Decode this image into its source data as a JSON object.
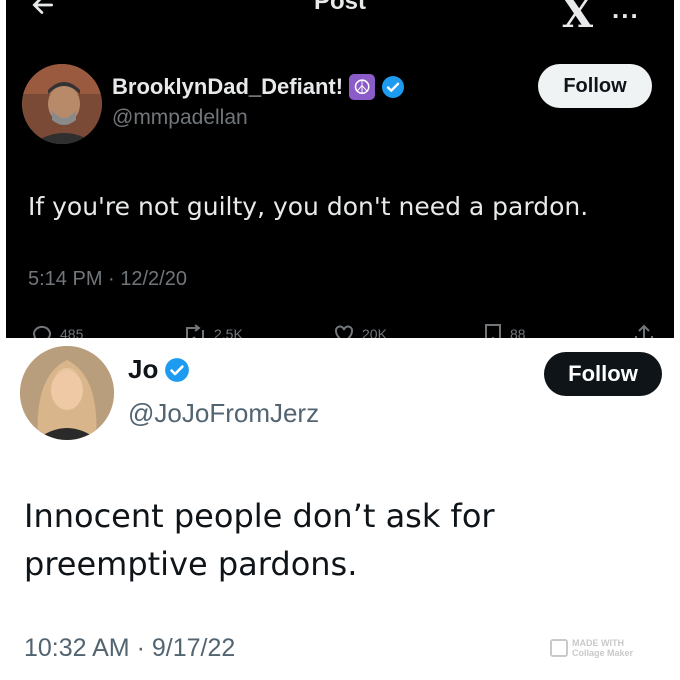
{
  "top_panel": {
    "header": {
      "title": "Post",
      "x_logo": "X",
      "more": "..."
    },
    "author": {
      "name": "BrooklynDad_Defiant!",
      "emoji": "☮",
      "handle": "@mmpadellan",
      "verified": true
    },
    "follow_label": "Follow",
    "text": "If you're not guilty, you don't need a pardon.",
    "timestamp": "5:14 PM · 12/2/20",
    "actions": {
      "replies": "485",
      "reposts": "2.5K",
      "likes": "20K",
      "bookmarks": "88"
    }
  },
  "bottom_panel": {
    "author": {
      "name": "Jo",
      "handle": "@JoJoFromJerz",
      "verified": true
    },
    "follow_label": "Follow",
    "text": "Innocent people don’t ask for preemptive pardons.",
    "timestamp": "10:32 AM · 9/17/22"
  },
  "watermark": {
    "line1": "MADE WITH",
    "line2": "Collage Maker"
  },
  "colors": {
    "verified_blue": "#1d9bf0",
    "dark_bg": "#000000",
    "dark_text": "#e7e9ea",
    "dark_muted": "#71767b",
    "light_text": "#0f1419",
    "light_muted": "#536471",
    "peace_purple": "#8b5cc8"
  },
  "icons": [
    "back-arrow-icon",
    "x-logo-icon",
    "more-icon",
    "verified-badge-icon",
    "peace-symbol-icon",
    "reply-icon",
    "repost-icon",
    "like-icon",
    "bookmark-icon",
    "share-icon"
  ]
}
